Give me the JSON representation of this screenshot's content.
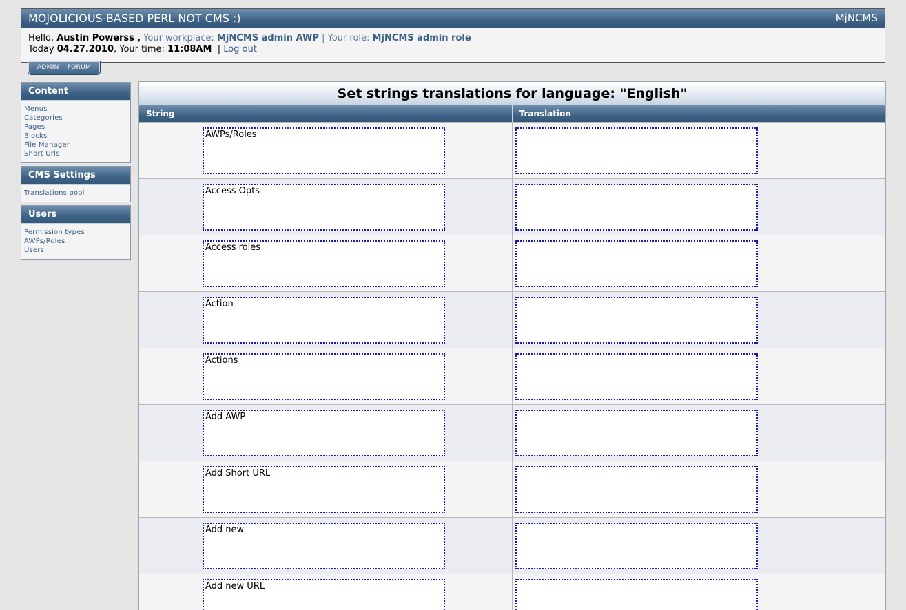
{
  "header": {
    "title": "MOJOLICIOUS-BASED PERL NOT CMS :)",
    "brand": "MjNCMS",
    "hello_prefix": "Hello,",
    "username": "Austin Powerss",
    "user_suffix": ",",
    "workplace_label": "Your workplace:",
    "workplace": "MjNCMS admin AWP",
    "sep": "|",
    "role_label": "Your role:",
    "role": "MjNCMS admin role",
    "today_label": "Today",
    "date": "04.27.2010",
    "time_label": ", Your time:",
    "time": "11:08AM",
    "logout": "Log out"
  },
  "tabs": [
    "ADMIN",
    "FORUM"
  ],
  "sidebar": [
    {
      "title": "Content",
      "items": [
        "Menus",
        "Categories",
        "Pages",
        "Blocks",
        "File Manager",
        "Short Urls"
      ]
    },
    {
      "title": "CMS Settings",
      "items": [
        "Translations pool"
      ]
    },
    {
      "title": "Users",
      "items": [
        "Permission types",
        "AWPs/Roles",
        "Users"
      ]
    }
  ],
  "main": {
    "title": "Set strings translations for language: \"English\"",
    "columns": [
      "String",
      "Translation"
    ],
    "rows": [
      {
        "string": "AWPs/Roles",
        "translation": ""
      },
      {
        "string": "Access Opts",
        "translation": ""
      },
      {
        "string": "Access roles",
        "translation": ""
      },
      {
        "string": "Action",
        "translation": ""
      },
      {
        "string": "Actions",
        "translation": ""
      },
      {
        "string": "Add AWP",
        "translation": ""
      },
      {
        "string": "Add Short URL",
        "translation": ""
      },
      {
        "string": "Add new",
        "translation": ""
      },
      {
        "string": "Add new URL",
        "translation": ""
      }
    ]
  }
}
